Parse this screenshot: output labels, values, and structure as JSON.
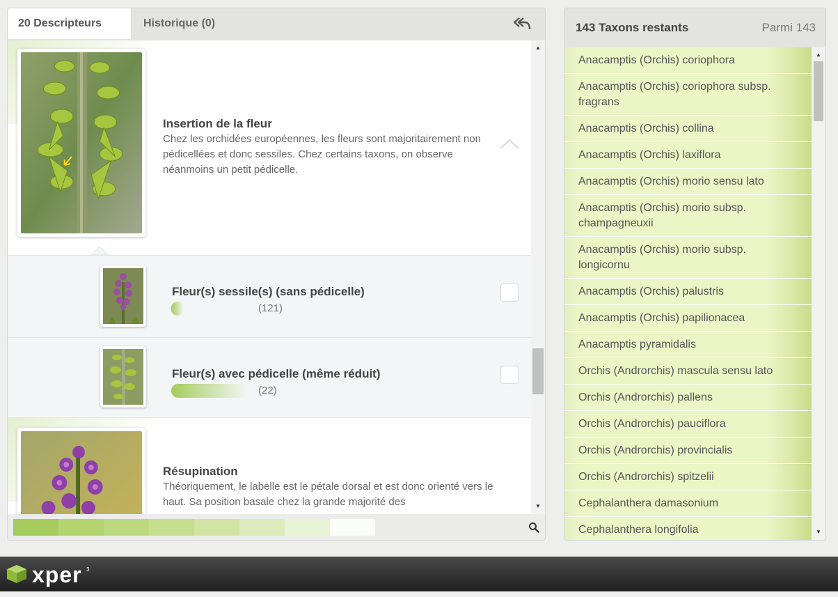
{
  "tabs": {
    "descripteurs": "20 Descripteurs",
    "historique": "Historique (0)"
  },
  "descriptors": [
    {
      "title": "Insertion de la fleur",
      "text": "Chez les orchidées européennes, les fleurs sont majoritairement non pédicellées et donc sessiles. Chez certains taxons, on observe néanmoins un petit pédicelle.",
      "states": [
        {
          "label": "Fleur(s) sessile(s) (sans pédicelle)",
          "count": "(121)",
          "fraction": 0.12
        },
        {
          "label": "Fleur(s) avec pédicelle (même réduit)",
          "count": "(22)",
          "fraction": 0.9
        }
      ]
    },
    {
      "title": "Résupination",
      "text": "Théoriquement, le labelle est le pétale dorsal et est donc orienté vers le haut. Sa position basale chez la grande majorité des"
    }
  ],
  "progress_colors": [
    "#a5cc5c",
    "#b3d46f",
    "#bcd97f",
    "#c5de8f",
    "#d0e4a3",
    "#dbebbb",
    "#e9f3d6",
    "#fbfdf8"
  ],
  "taxa": {
    "title": "143 Taxons restants",
    "total": "Parmi 143",
    "items": [
      "Anacamptis (Orchis) coriophora",
      "Anacamptis (Orchis) coriophora subsp. fragrans",
      "Anacamptis (Orchis) collina",
      "Anacamptis (Orchis) laxiflora",
      "Anacamptis (Orchis) morio sensu lato",
      "Anacamptis (Orchis) morio subsp. champagneuxii",
      "Anacamptis (Orchis) morio subsp. longicornu",
      "Anacamptis (Orchis) palustris",
      "Anacamptis (Orchis) papilionacea",
      "Anacamptis pyramidalis",
      "Orchis (Androrchis) mascula sensu lato",
      "Orchis (Androrchis) pallens",
      "Orchis (Androrchis) pauciflora",
      "Orchis (Androrchis) provincialis",
      "Orchis (Androrchis) spitzelii",
      "Cephalanthera damasonium",
      "Cephalanthera longifolia"
    ]
  },
  "footer": {
    "logo": "xper",
    "logo_sup": "3"
  },
  "icons": {
    "back": "reply-all-icon",
    "collapse": "chevron-up-icon",
    "search": "search-icon",
    "logo": "xper-cube-icon"
  },
  "colors": {
    "accent_green": "#a5cc5c",
    "taxon_bg": "#ecf5c6",
    "footer_dark": "#2a2a2a"
  }
}
